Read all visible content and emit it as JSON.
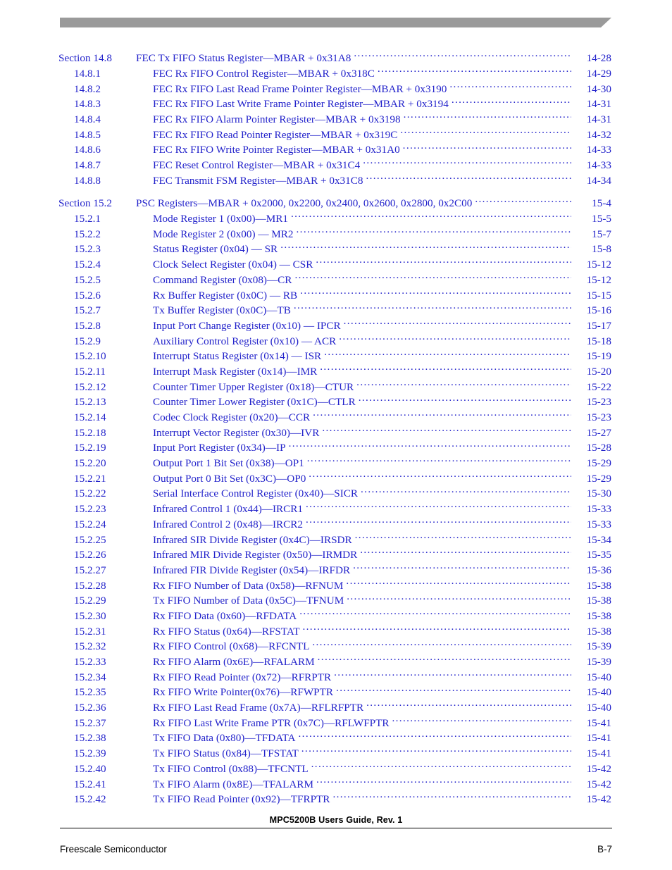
{
  "colors": {
    "link_blue": "#2323CB",
    "header_bar_gray": "#9A9A9A",
    "body_black": "#000000"
  },
  "header": {
    "bar_name": "decorative-header-bar"
  },
  "toc": {
    "rows": [
      {
        "level": 1,
        "number": "Section 14.8",
        "title": "FEC Tx FIFO Status Register—MBAR + 0x31A8",
        "page": "14-28",
        "gap": false
      },
      {
        "level": 2,
        "number": "14.8.1",
        "title": "FEC Rx FIFO Control Register—MBAR + 0x318C",
        "page": "14-29",
        "gap": false
      },
      {
        "level": 2,
        "number": "14.8.2",
        "title": "FEC Rx FIFO Last Read Frame Pointer Register—MBAR + 0x3190",
        "page": "14-30",
        "gap": false
      },
      {
        "level": 2,
        "number": "14.8.3",
        "title": "FEC Rx FIFO Last Write Frame Pointer Register—MBAR + 0x3194",
        "page": "14-31",
        "gap": false
      },
      {
        "level": 2,
        "number": "14.8.4",
        "title": "FEC Rx FIFO Alarm Pointer Register—MBAR + 0x3198",
        "page": "14-31",
        "gap": false
      },
      {
        "level": 2,
        "number": "14.8.5",
        "title": "FEC Rx FIFO Read Pointer Register—MBAR + 0x319C",
        "page": "14-32",
        "gap": false
      },
      {
        "level": 2,
        "number": "14.8.6",
        "title": "FEC Rx FIFO Write Pointer Register—MBAR + 0x31A0",
        "page": "14-33",
        "gap": false
      },
      {
        "level": 2,
        "number": "14.8.7",
        "title": "FEC Reset Control Register—MBAR + 0x31C4",
        "page": "14-33",
        "gap": false
      },
      {
        "level": 2,
        "number": "14.8.8",
        "title": "FEC Transmit FSM Register—MBAR + 0x31C8",
        "page": "14-34",
        "gap": false
      },
      {
        "level": 1,
        "number": "Section 15.2",
        "title": "PSC Registers—MBAR + 0x2000, 0x2200, 0x2400, 0x2600, 0x2800, 0x2C00",
        "page": "15-4",
        "gap": true
      },
      {
        "level": 2,
        "number": "15.2.1",
        "title": "Mode Register 1 (0x00)—MR1",
        "page": "15-5",
        "gap": false
      },
      {
        "level": 2,
        "number": "15.2.2",
        "title": "Mode Register 2 (0x00) — MR2",
        "page": "15-7",
        "gap": false
      },
      {
        "level": 2,
        "number": "15.2.3",
        "title": "Status Register (0x04) — SR",
        "page": "15-8",
        "gap": false
      },
      {
        "level": 2,
        "number": "15.2.4",
        "title": "Clock Select Register (0x04) — CSR",
        "page": "15-12",
        "gap": false
      },
      {
        "level": 2,
        "number": "15.2.5",
        "title": "Command Register (0x08)—CR",
        "page": "15-12",
        "gap": false
      },
      {
        "level": 2,
        "number": "15.2.6",
        "title": "Rx Buffer Register (0x0C) — RB",
        "page": "15-15",
        "gap": false
      },
      {
        "level": 2,
        "number": "15.2.7",
        "title": "Tx Buffer Register (0x0C)—TB",
        "page": "15-16",
        "gap": false
      },
      {
        "level": 2,
        "number": "15.2.8",
        "title": "Input Port Change Register (0x10) — IPCR",
        "page": "15-17",
        "gap": false
      },
      {
        "level": 2,
        "number": "15.2.9",
        "title": "Auxiliary Control Register (0x10) — ACR",
        "page": "15-18",
        "gap": false
      },
      {
        "level": 2,
        "number": "15.2.10",
        "title": "Interrupt Status Register (0x14) — ISR",
        "page": "15-19",
        "gap": false
      },
      {
        "level": 2,
        "number": "15.2.11",
        "title": "Interrupt Mask Register (0x14)—IMR",
        "page": "15-20",
        "gap": false
      },
      {
        "level": 2,
        "number": "15.2.12",
        "title": "Counter Timer Upper Register (0x18)—CTUR",
        "page": "15-22",
        "gap": false
      },
      {
        "level": 2,
        "number": "15.2.13",
        "title": "Counter Timer Lower Register (0x1C)—CTLR",
        "page": "15-23",
        "gap": false
      },
      {
        "level": 2,
        "number": "15.2.14",
        "title": "Codec Clock Register (0x20)—CCR",
        "page": "15-23",
        "gap": false
      },
      {
        "level": 2,
        "number": "15.2.18",
        "title": "Interrupt Vector Register (0x30)—IVR",
        "page": "15-27",
        "gap": false
      },
      {
        "level": 2,
        "number": "15.2.19",
        "title": "Input Port Register (0x34)—IP",
        "page": "15-28",
        "gap": false
      },
      {
        "level": 2,
        "number": "15.2.20",
        "title": "Output Port 1 Bit Set (0x38)—OP1",
        "page": "15-29",
        "gap": false
      },
      {
        "level": 2,
        "number": "15.2.21",
        "title": "Output Port 0 Bit Set (0x3C)—OP0",
        "page": "15-29",
        "gap": false
      },
      {
        "level": 2,
        "number": "15.2.22",
        "title": "Serial Interface Control Register (0x40)—SICR",
        "page": "15-30",
        "gap": false
      },
      {
        "level": 2,
        "number": "15.2.23",
        "title": "Infrared Control 1 (0x44)—IRCR1",
        "page": "15-33",
        "gap": false
      },
      {
        "level": 2,
        "number": "15.2.24",
        "title": "Infrared Control 2 (0x48)—IRCR2",
        "page": "15-33",
        "gap": false
      },
      {
        "level": 2,
        "number": "15.2.25",
        "title": "Infrared SIR Divide Register (0x4C)—IRSDR",
        "page": "15-34",
        "gap": false
      },
      {
        "level": 2,
        "number": "15.2.26",
        "title": "Infrared MIR Divide Register (0x50)—IRMDR",
        "page": "15-35",
        "gap": false
      },
      {
        "level": 2,
        "number": "15.2.27",
        "title": "Infrared FIR Divide Register (0x54)—IRFDR",
        "page": "15-36",
        "gap": false
      },
      {
        "level": 2,
        "number": "15.2.28",
        "title": "Rx FIFO Number of Data (0x58)—RFNUM",
        "page": "15-38",
        "gap": false
      },
      {
        "level": 2,
        "number": "15.2.29",
        "title": "Tx FIFO Number of Data (0x5C)—TFNUM",
        "page": "15-38",
        "gap": false
      },
      {
        "level": 2,
        "number": "15.2.30",
        "title": "Rx FIFO Data (0x60)—RFDATA",
        "page": "15-38",
        "gap": false
      },
      {
        "level": 2,
        "number": "15.2.31",
        "title": "Rx FIFO Status (0x64)—RFSTAT",
        "page": "15-38",
        "gap": false
      },
      {
        "level": 2,
        "number": "15.2.32",
        "title": "Rx FIFO Control (0x68)—RFCNTL",
        "page": "15-39",
        "gap": false
      },
      {
        "level": 2,
        "number": "15.2.33",
        "title": "Rx FIFO Alarm (0x6E)—RFALARM",
        "page": "15-39",
        "gap": false
      },
      {
        "level": 2,
        "number": "15.2.34",
        "title": "Rx FIFO Read Pointer (0x72)—RFRPTR",
        "page": "15-40",
        "gap": false
      },
      {
        "level": 2,
        "number": "15.2.35",
        "title": "Rx FIFO Write Pointer(0x76)—RFWPTR",
        "page": "15-40",
        "gap": false
      },
      {
        "level": 2,
        "number": "15.2.36",
        "title": "Rx FIFO Last Read Frame (0x7A)—RFLRFPTR",
        "page": "15-40",
        "gap": false
      },
      {
        "level": 2,
        "number": "15.2.37",
        "title": "Rx FIFO Last Write Frame PTR (0x7C)—RFLWFPTR",
        "page": "15-41",
        "gap": false
      },
      {
        "level": 2,
        "number": "15.2.38",
        "title": "Tx FIFO Data (0x80)—TFDATA",
        "page": "15-41",
        "gap": false
      },
      {
        "level": 2,
        "number": "15.2.39",
        "title": "Tx FIFO Status (0x84)—TFSTAT",
        "page": "15-41",
        "gap": false
      },
      {
        "level": 2,
        "number": "15.2.40",
        "title": "Tx FIFO Control (0x88)—TFCNTL",
        "page": "15-42",
        "gap": false
      },
      {
        "level": 2,
        "number": "15.2.41",
        "title": "Tx FIFO Alarm (0x8E)—TFALARM",
        "page": "15-42",
        "gap": false
      },
      {
        "level": 2,
        "number": "15.2.42",
        "title": "Tx FIFO Read Pointer (0x92)—TFRPTR",
        "page": "15-42",
        "gap": false
      }
    ]
  },
  "footer": {
    "document_title": "MPC5200B Users Guide, Rev. 1",
    "company": "Freescale Semiconductor",
    "page_number": "B-7"
  }
}
